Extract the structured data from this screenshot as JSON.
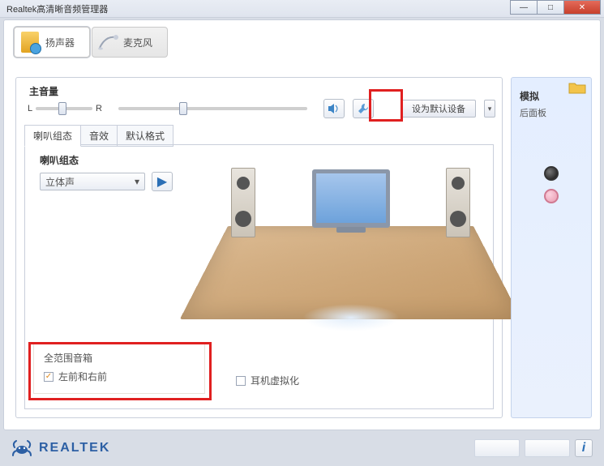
{
  "window": {
    "title": "Realtek高清晰音频管理器"
  },
  "tabs_device": {
    "speaker": "扬声器",
    "mic": "麦克风"
  },
  "volume": {
    "label": "主音量",
    "L": "L",
    "R": "R",
    "set_default": "设为默认设备"
  },
  "tabs_cfg": {
    "config": "喇叭组态",
    "effects": "音效",
    "format": "默认格式"
  },
  "speaker_config": {
    "label": "喇叭组态",
    "selected": "立体声"
  },
  "fullrange": {
    "title": "全范围音箱",
    "opt1": "左前和右前"
  },
  "headphone_virt": "耳机虚拟化",
  "right": {
    "title": "模拟",
    "sub": "后面板"
  },
  "brand": "REALTEK",
  "info_i": "i",
  "chev": "▾",
  "check": "✓",
  "play": "▶"
}
